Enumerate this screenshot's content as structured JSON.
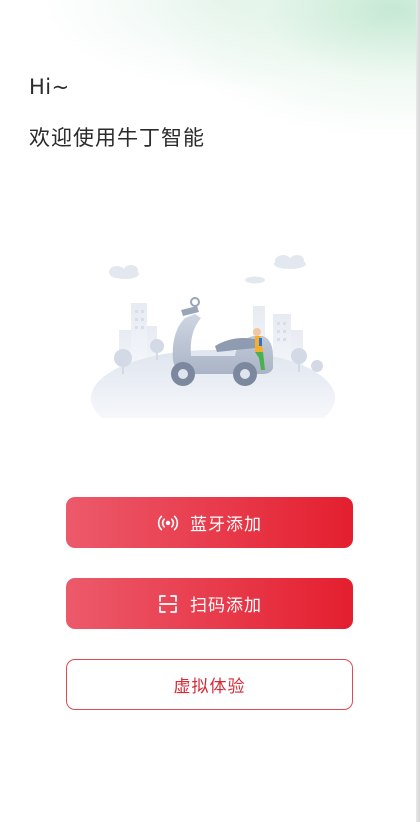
{
  "header": {
    "greeting": "Hi~",
    "welcome": "欢迎使用牛丁智能"
  },
  "illustration": {
    "icon": "scooter-city-illustration"
  },
  "actions": {
    "bluetooth": {
      "label": "蓝牙添加",
      "icon": "bluetooth-signal-icon"
    },
    "scan": {
      "label": "扫码添加",
      "icon": "scan-icon"
    },
    "virtual": {
      "label": "虚拟体验"
    }
  },
  "colors": {
    "primary_start": "#ec5a6b",
    "primary_end": "#e41f2f",
    "outline": "#e04a55",
    "text": "#2b2b2b"
  }
}
